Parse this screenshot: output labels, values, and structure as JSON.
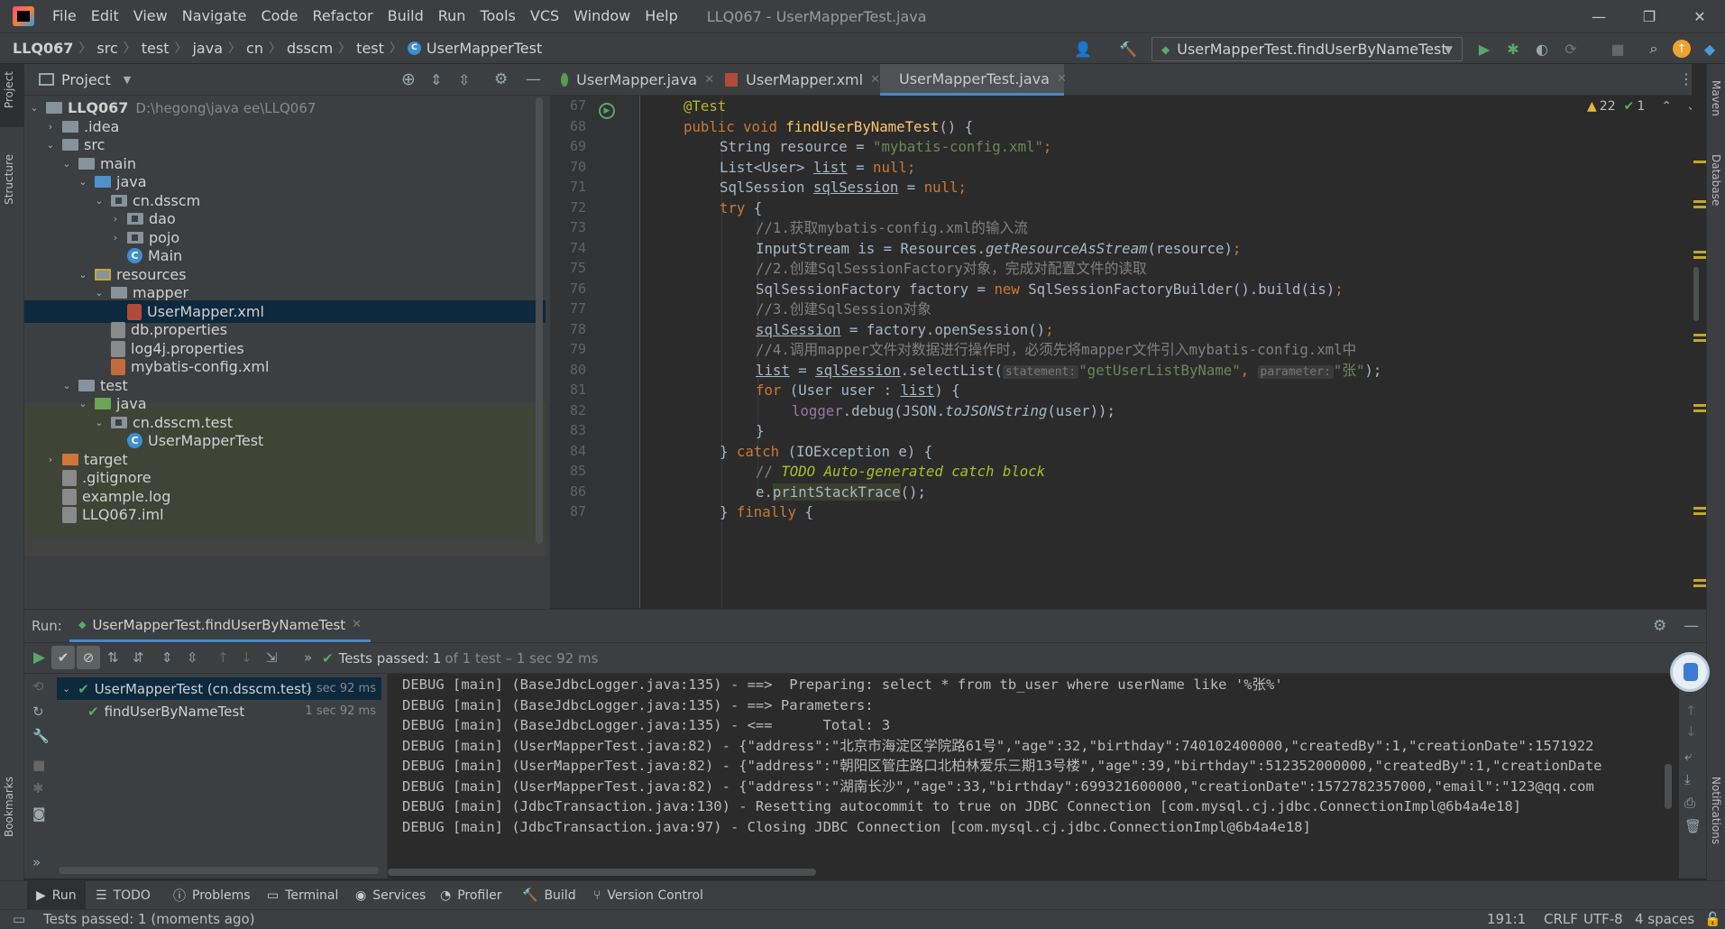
{
  "window": {
    "title": "LLQ067 - UserMapperTest.java",
    "menu": [
      "File",
      "Edit",
      "View",
      "Navigate",
      "Code",
      "Refactor",
      "Build",
      "Run",
      "Tools",
      "VCS",
      "Window",
      "Help"
    ]
  },
  "breadcrumbs": [
    "LLQ067",
    "src",
    "test",
    "java",
    "cn",
    "dsscm",
    "test",
    "UserMapperTest"
  ],
  "run_config": "UserMapperTest.findUserByNameTest",
  "project": {
    "header": "Project",
    "tree": [
      {
        "label": "LLQ067",
        "extra": "D:\\hegong\\java ee\\LLQ067"
      },
      {
        "label": ".idea"
      },
      {
        "label": "src"
      },
      {
        "label": "main"
      },
      {
        "label": "java"
      },
      {
        "label": "cn.dsscm"
      },
      {
        "label": "dao"
      },
      {
        "label": "pojo"
      },
      {
        "label": "Main"
      },
      {
        "label": "resources"
      },
      {
        "label": "mapper"
      },
      {
        "label": "UserMapper.xml"
      },
      {
        "label": "db.properties"
      },
      {
        "label": "log4j.properties"
      },
      {
        "label": "mybatis-config.xml"
      },
      {
        "label": "test"
      },
      {
        "label": "java"
      },
      {
        "label": "cn.dsscm.test"
      },
      {
        "label": "UserMapperTest"
      },
      {
        "label": "target"
      },
      {
        "label": ".gitignore"
      },
      {
        "label": "example.log"
      },
      {
        "label": "LLQ067.iml"
      }
    ]
  },
  "tabs": [
    "UserMapper.java",
    "UserMapper.xml",
    "UserMapperTest.java"
  ],
  "inspection": {
    "warnings": "22",
    "ok": "1"
  },
  "code": {
    "lines": [
      "67",
      "68",
      "69",
      "70",
      "71",
      "72",
      "73",
      "74",
      "75",
      "76",
      "77",
      "78",
      "79",
      "80",
      "81",
      "82",
      "83",
      "84",
      "85",
      "86",
      "87"
    ],
    "t": {
      "l67": "@Test",
      "l68a": "public void ",
      "l68b": "findUserByNameTest",
      "l68c": "() {",
      "l69a": "String resource = ",
      "l69b": "\"mybatis-config.xml\"",
      "l70a": "List<User> ",
      "l70b": "list",
      "l70c": " = ",
      "l70d": "null",
      "l71a": "SqlSession ",
      "l71b": "sqlSession",
      "l71c": " = ",
      "l71d": "null",
      "l72": "try",
      "l73": "//1.获取mybatis-config.xml的输入流",
      "l74a": "InputStream is = Resources.",
      "l74b": "getResourceAsStream",
      "l74c": "(resource)",
      "l75": "//2.创建SqlSessionFactory对象，完成对配置文件的读取",
      "l76a": "SqlSessionFactory factory = ",
      "l76b": "new",
      "l76c": " SqlSessionFactoryBuilder().build(is)",
      "l77": "//3.创建SqlSession对象",
      "l78a": "sqlSession",
      "l78b": " = factory.openSession()",
      "l79": "//4.调用mapper文件对数据进行操作时，必须先将mapper文件引入mybatis-config.xml中",
      "l80a": "list",
      "l80b": " = ",
      "l80c": "sqlSession",
      "l80d": ".selectList(",
      "l80hint1": "statement:",
      "l80e": "\"getUserListByName\"",
      "l80f": ", ",
      "l80hint2": "parameter:",
      "l80g": "\"张\"",
      "l80h": ");",
      "l81a": "for",
      "l81b": " (User user : ",
      "l81c": "list",
      "l81d": ") {",
      "l82a": "logger",
      "l82b": ".debug(JSON.",
      "l82c": "toJSONString",
      "l82d": "(user));",
      "l83": "}",
      "l84a": "} ",
      "l84b": "catch",
      "l84c": " (IOException e) {",
      "l85a": "// ",
      "l85b": "TODO Auto-generated catch block",
      "l86a": "e.",
      "l86b": "printStackTrace",
      "l86c": "();",
      "l87a": "} ",
      "l87b": "finally",
      "l87c": " {"
    }
  },
  "run": {
    "label": "Run:",
    "tab": "UserMapperTest.findUserByNameTest",
    "status_prefix": "Tests passed:",
    "status_count": "1",
    "status_rest": "of 1 test – 1 sec 92 ms",
    "tests": [
      {
        "name": "UserMapperTest (cn.dsscm.test)",
        "time": "1 sec 92 ms"
      },
      {
        "name": "findUserByNameTest",
        "time": "1 sec 92 ms"
      }
    ],
    "console": [
      "DEBUG [main] (BaseJdbcLogger.java:135) - ==>  Preparing: select * from tb_user where userName like '%张%'",
      "DEBUG [main] (BaseJdbcLogger.java:135) - ==> Parameters: ",
      "DEBUG [main] (BaseJdbcLogger.java:135) - <==      Total: 3",
      "DEBUG [main] (UserMapperTest.java:82) - {\"address\":\"北京市海淀区学院路61号\",\"age\":32,\"birthday\":740102400000,\"createdBy\":1,\"creationDate\":1571922",
      "DEBUG [main] (UserMapperTest.java:82) - {\"address\":\"朝阳区管庄路口北柏林爱乐三期13号楼\",\"age\":39,\"birthday\":512352000000,\"createdBy\":1,\"creationDate",
      "DEBUG [main] (UserMapperTest.java:82) - {\"address\":\"湖南长沙\",\"age\":33,\"birthday\":699321600000,\"creationDate\":1572782357000,\"email\":\"123@qq.com",
      "DEBUG [main] (JdbcTransaction.java:130) - Resetting autocommit to true on JDBC Connection [com.mysql.cj.jdbc.ConnectionImpl@6b4a4e18]",
      "DEBUG [main] (JdbcTransaction.java:97) - Closing JDBC Connection [com.mysql.cj.jdbc.ConnectionImpl@6b4a4e18]"
    ]
  },
  "bottom_tabs": [
    "Run",
    "TODO",
    "Problems",
    "Terminal",
    "Services",
    "Profiler",
    "Build",
    "Version Control"
  ],
  "status": {
    "message": "Tests passed: 1 (moments ago)",
    "position": "191:1",
    "line_sep": "CRLF",
    "encoding": "UTF-8",
    "indent": "4 spaces"
  },
  "side_tools": {
    "left": [
      "Project",
      "Structure",
      "Bookmarks"
    ],
    "right": [
      "Maven",
      "Database",
      "Notifications"
    ]
  },
  "colors": {
    "accent": "#4a88c7",
    "keyword": "#cc7832",
    "string": "#6a8759",
    "comment": "#808080",
    "pass": "#59a869"
  }
}
